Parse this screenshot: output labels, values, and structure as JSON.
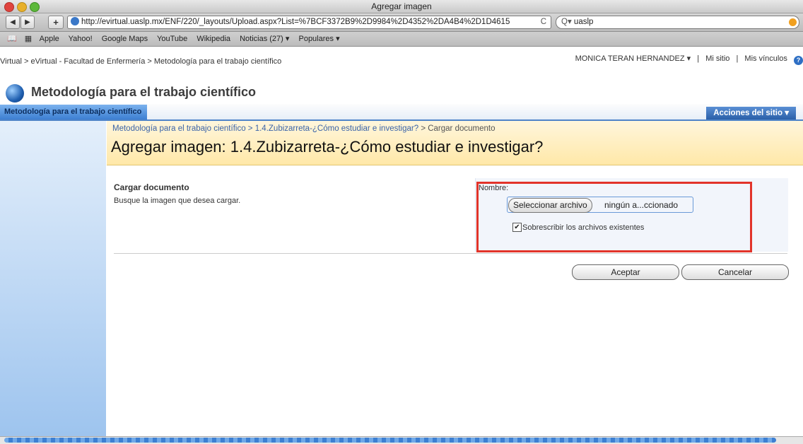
{
  "window": {
    "title": "Agregar imagen"
  },
  "toolbar": {
    "back": "◀",
    "forward": "▶",
    "add": "+",
    "url": "http://evirtual.uaslp.mx/ENF/220/_layouts/Upload.aspx?List=%7BCF3372B9%2D9984%2D4352%2DA4B4%2D1D4615",
    "reload": "C",
    "search": "uaslp"
  },
  "bookmarks": [
    "Apple",
    "Yahoo!",
    "Google Maps",
    "YouTube",
    "Wikipedia",
    "Noticias (27) ▾",
    "Populares ▾"
  ],
  "topbar": {
    "breadcrumb": "Virtual > eVirtual - Facultad de Enfermería > Metodología para el trabajo científico",
    "user": "MONICA TERAN HERNANDEZ ▾",
    "sep": "|",
    "mysite": "Mi sitio",
    "mylinks": "Mis vínculos",
    "help": "?"
  },
  "site": {
    "title": "Metodología para el trabajo científico"
  },
  "nav": {
    "tab": "Metodología para el trabajo científico",
    "actions": "Acciones del sitio ▾"
  },
  "header": {
    "crumb_link1": "Metodología para el trabajo científico",
    "crumb_link2": "1.4.Zubizarreta-¿Cómo estudiar e investigar?",
    "crumb_current": "Cargar documento",
    "title": "Agregar imagen: 1.4.Zubizarreta-¿Cómo estudiar e investigar?"
  },
  "form": {
    "section_title": "Cargar documento",
    "section_desc": "Busque la imagen que desea cargar.",
    "name_label": "Nombre:",
    "file_button": "Seleccionar archivo",
    "file_name": "ningún a...ccionado",
    "overwrite_label": "Sobrescribir los archivos existentes",
    "overwrite_checked": true
  },
  "buttons": {
    "ok": "Aceptar",
    "cancel": "Cancelar"
  }
}
